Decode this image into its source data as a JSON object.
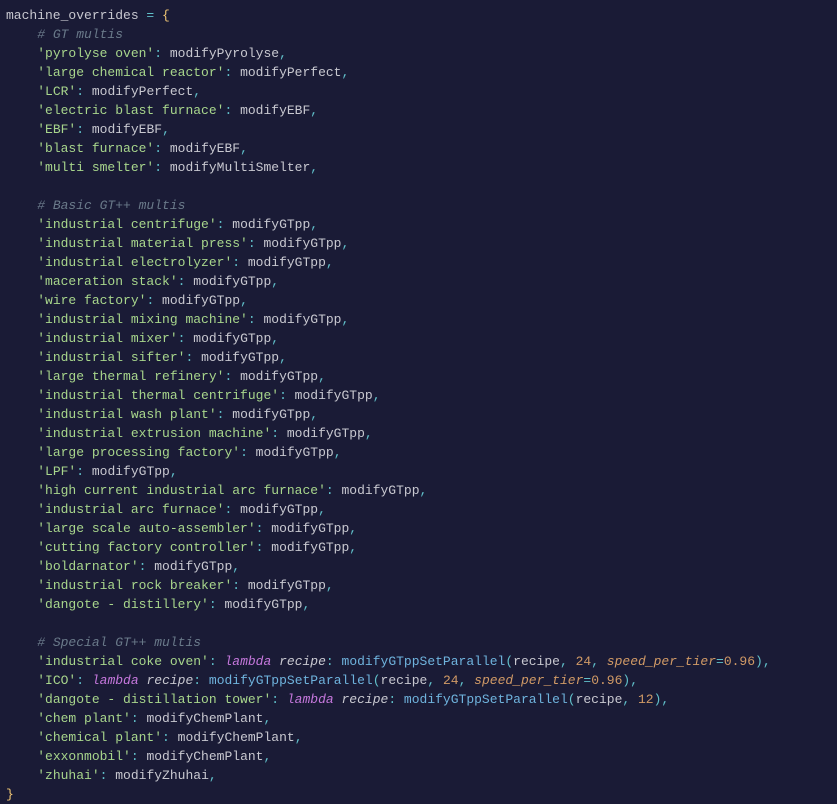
{
  "code": {
    "var_name": "machine_overrides",
    "eq": " = ",
    "open_brace": "{",
    "close_brace": "}",
    "indent1": "    ",
    "indent2": "        ",
    "comment_gt_multis": "# GT multis",
    "comment_basic_gtpp": "# Basic GT++ multis",
    "comment_special_gtpp": "# Special GT++ multis",
    "colon_sep": ": ",
    "comma": ",",
    "lambda_kw": "lambda",
    "lambda_param": "recipe",
    "lambda_colon": ": ",
    "open_paren": "(",
    "close_paren": ")",
    "arg_recipe": "recipe",
    "arg_sep": ", ",
    "kwarg_speed": "speed_per_tier",
    "kwarg_eq": "=",
    "gt_multis": [
      {
        "key": "'pyrolyse oven'",
        "val": "modifyPyrolyse"
      },
      {
        "key": "'large chemical reactor'",
        "val": "modifyPerfect"
      },
      {
        "key": "'LCR'",
        "val": "modifyPerfect"
      },
      {
        "key": "'electric blast furnace'",
        "val": "modifyEBF"
      },
      {
        "key": "'EBF'",
        "val": "modifyEBF"
      },
      {
        "key": "'blast furnace'",
        "val": "modifyEBF"
      },
      {
        "key": "'multi smelter'",
        "val": "modifyMultiSmelter"
      }
    ],
    "basic_gtpp": [
      {
        "key": "'industrial centrifuge'",
        "val": "modifyGTpp"
      },
      {
        "key": "'industrial material press'",
        "val": "modifyGTpp"
      },
      {
        "key": "'industrial electrolyzer'",
        "val": "modifyGTpp"
      },
      {
        "key": "'maceration stack'",
        "val": "modifyGTpp"
      },
      {
        "key": "'wire factory'",
        "val": "modifyGTpp"
      },
      {
        "key": "'industrial mixing machine'",
        "val": "modifyGTpp"
      },
      {
        "key": "'industrial mixer'",
        "val": "modifyGTpp"
      },
      {
        "key": "'industrial sifter'",
        "val": "modifyGTpp"
      },
      {
        "key": "'large thermal refinery'",
        "val": "modifyGTpp"
      },
      {
        "key": "'industrial thermal centrifuge'",
        "val": "modifyGTpp"
      },
      {
        "key": "'industrial wash plant'",
        "val": "modifyGTpp"
      },
      {
        "key": "'industrial extrusion machine'",
        "val": "modifyGTpp"
      },
      {
        "key": "'large processing factory'",
        "val": "modifyGTpp"
      },
      {
        "key": "'LPF'",
        "val": "modifyGTpp"
      },
      {
        "key": "'high current industrial arc furnace'",
        "val": "modifyGTpp"
      },
      {
        "key": "'industrial arc furnace'",
        "val": "modifyGTpp"
      },
      {
        "key": "'large scale auto-assembler'",
        "val": "modifyGTpp"
      },
      {
        "key": "'cutting factory controller'",
        "val": "modifyGTpp"
      },
      {
        "key": "'boldarnator'",
        "val": "modifyGTpp"
      },
      {
        "key": "'industrial rock breaker'",
        "val": "modifyGTpp"
      },
      {
        "key": "'dangote - distillery'",
        "val": "modifyGTpp"
      }
    ],
    "special_gtpp_lambda": [
      {
        "key": "'industrial coke oven'",
        "call": "modifyGTppSetParallel",
        "num": "24",
        "speed": "0.96"
      },
      {
        "key": "'ICO'",
        "call": "modifyGTppSetParallel",
        "num": "24",
        "speed": "0.96"
      },
      {
        "key": "'dangote - distillation tower'",
        "call": "modifyGTppSetParallel",
        "num": "12",
        "speed": null
      }
    ],
    "special_gtpp_simple": [
      {
        "key": "'chem plant'",
        "val": "modifyChemPlant"
      },
      {
        "key": "'chemical plant'",
        "val": "modifyChemPlant"
      },
      {
        "key": "'exxonmobil'",
        "val": "modifyChemPlant"
      },
      {
        "key": "'zhuhai'",
        "val": "modifyZhuhai"
      }
    ]
  }
}
